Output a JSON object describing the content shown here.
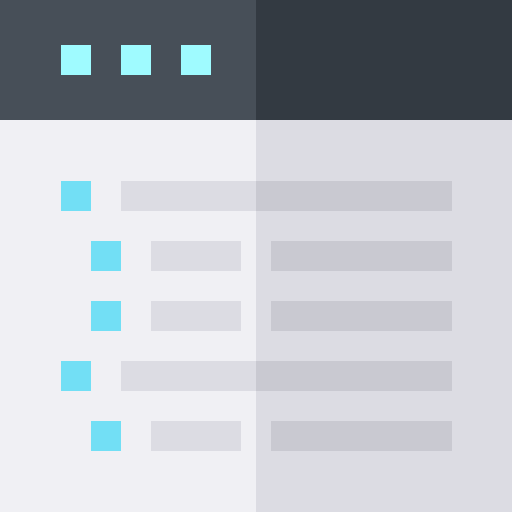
{
  "colors": {
    "header_left": "#474f58",
    "header_right": "#333a42",
    "header_dot": "#9ffbff",
    "body_left": "#f0f0f4",
    "body_right": "#dcdce3",
    "bullet": "#72dff5",
    "bar_on_left": "#dcdce3",
    "bar_on_right": "#c9c9d1"
  },
  "header": {
    "window_controls": [
      "dot-1",
      "dot-2",
      "dot-3"
    ]
  },
  "list": {
    "items": [
      {
        "level": 1,
        "kind": "parent"
      },
      {
        "level": 2,
        "kind": "child"
      },
      {
        "level": 2,
        "kind": "child"
      },
      {
        "level": 1,
        "kind": "parent"
      },
      {
        "level": 2,
        "kind": "child"
      }
    ]
  }
}
